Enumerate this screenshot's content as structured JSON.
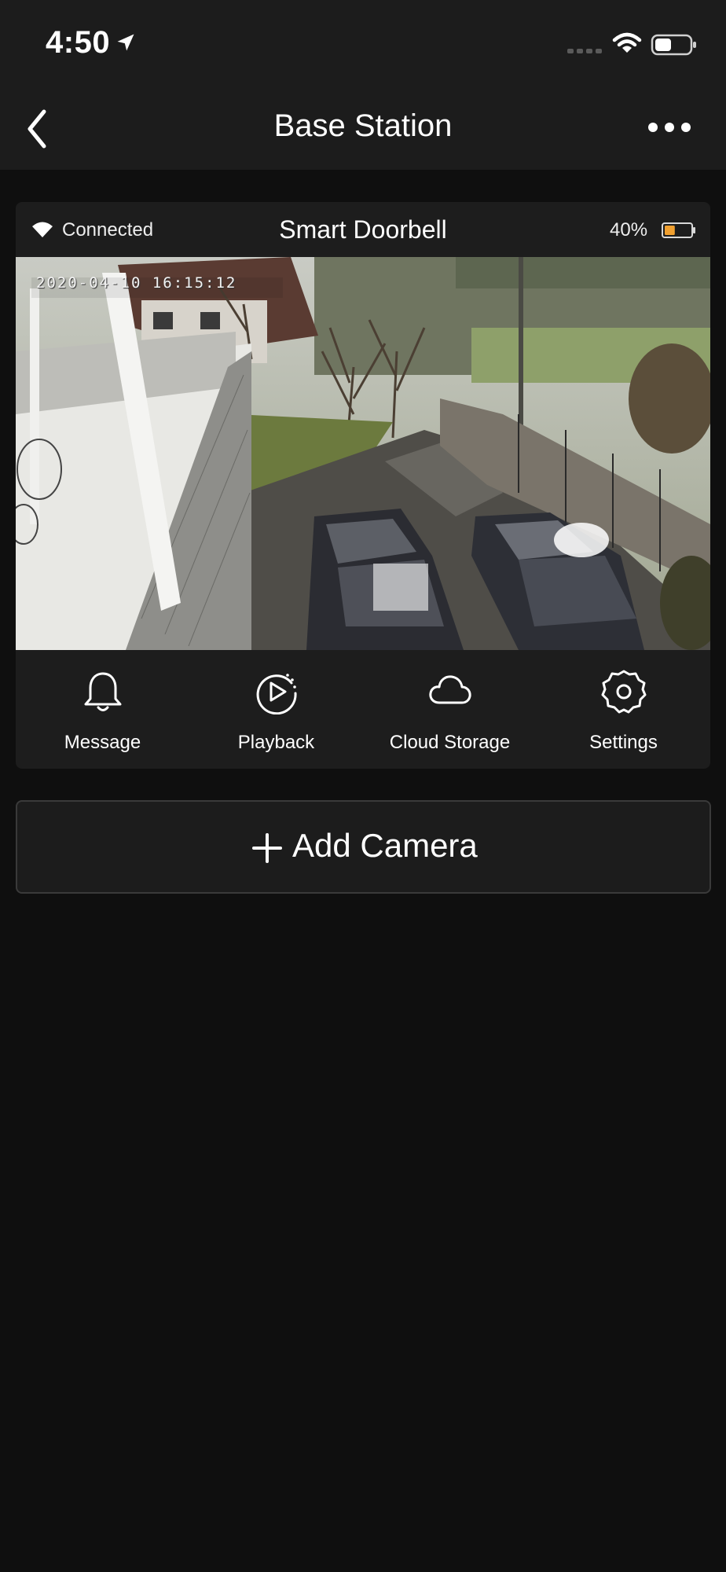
{
  "status_bar": {
    "time": "4:50",
    "icons": [
      "location-arrow-icon",
      "cellular-signal-icon",
      "wifi-icon",
      "battery-icon"
    ]
  },
  "nav": {
    "title": "Base Station",
    "back_icon": "chevron-left-icon",
    "more_icon": "more-horizontal-icon"
  },
  "camera_card": {
    "connection_status": "Connected",
    "device_name": "Smart Doorbell",
    "battery_percent": "40%",
    "battery_level": 0.4,
    "battery_color": "#f0a030",
    "feed_timestamp": "2020-04-10 16:15:12",
    "actions": [
      {
        "label": "Message",
        "icon": "bell-icon"
      },
      {
        "label": "Playback",
        "icon": "playback-icon"
      },
      {
        "label": "Cloud Storage",
        "icon": "cloud-icon"
      },
      {
        "label": "Settings",
        "icon": "gear-icon"
      }
    ]
  },
  "add_camera": {
    "label": "Add Camera",
    "icon": "plus-icon"
  },
  "colors": {
    "background": "#0f0f0f",
    "surface": "#1c1c1c",
    "text": "#ffffff",
    "accent_battery": "#f0a030"
  }
}
